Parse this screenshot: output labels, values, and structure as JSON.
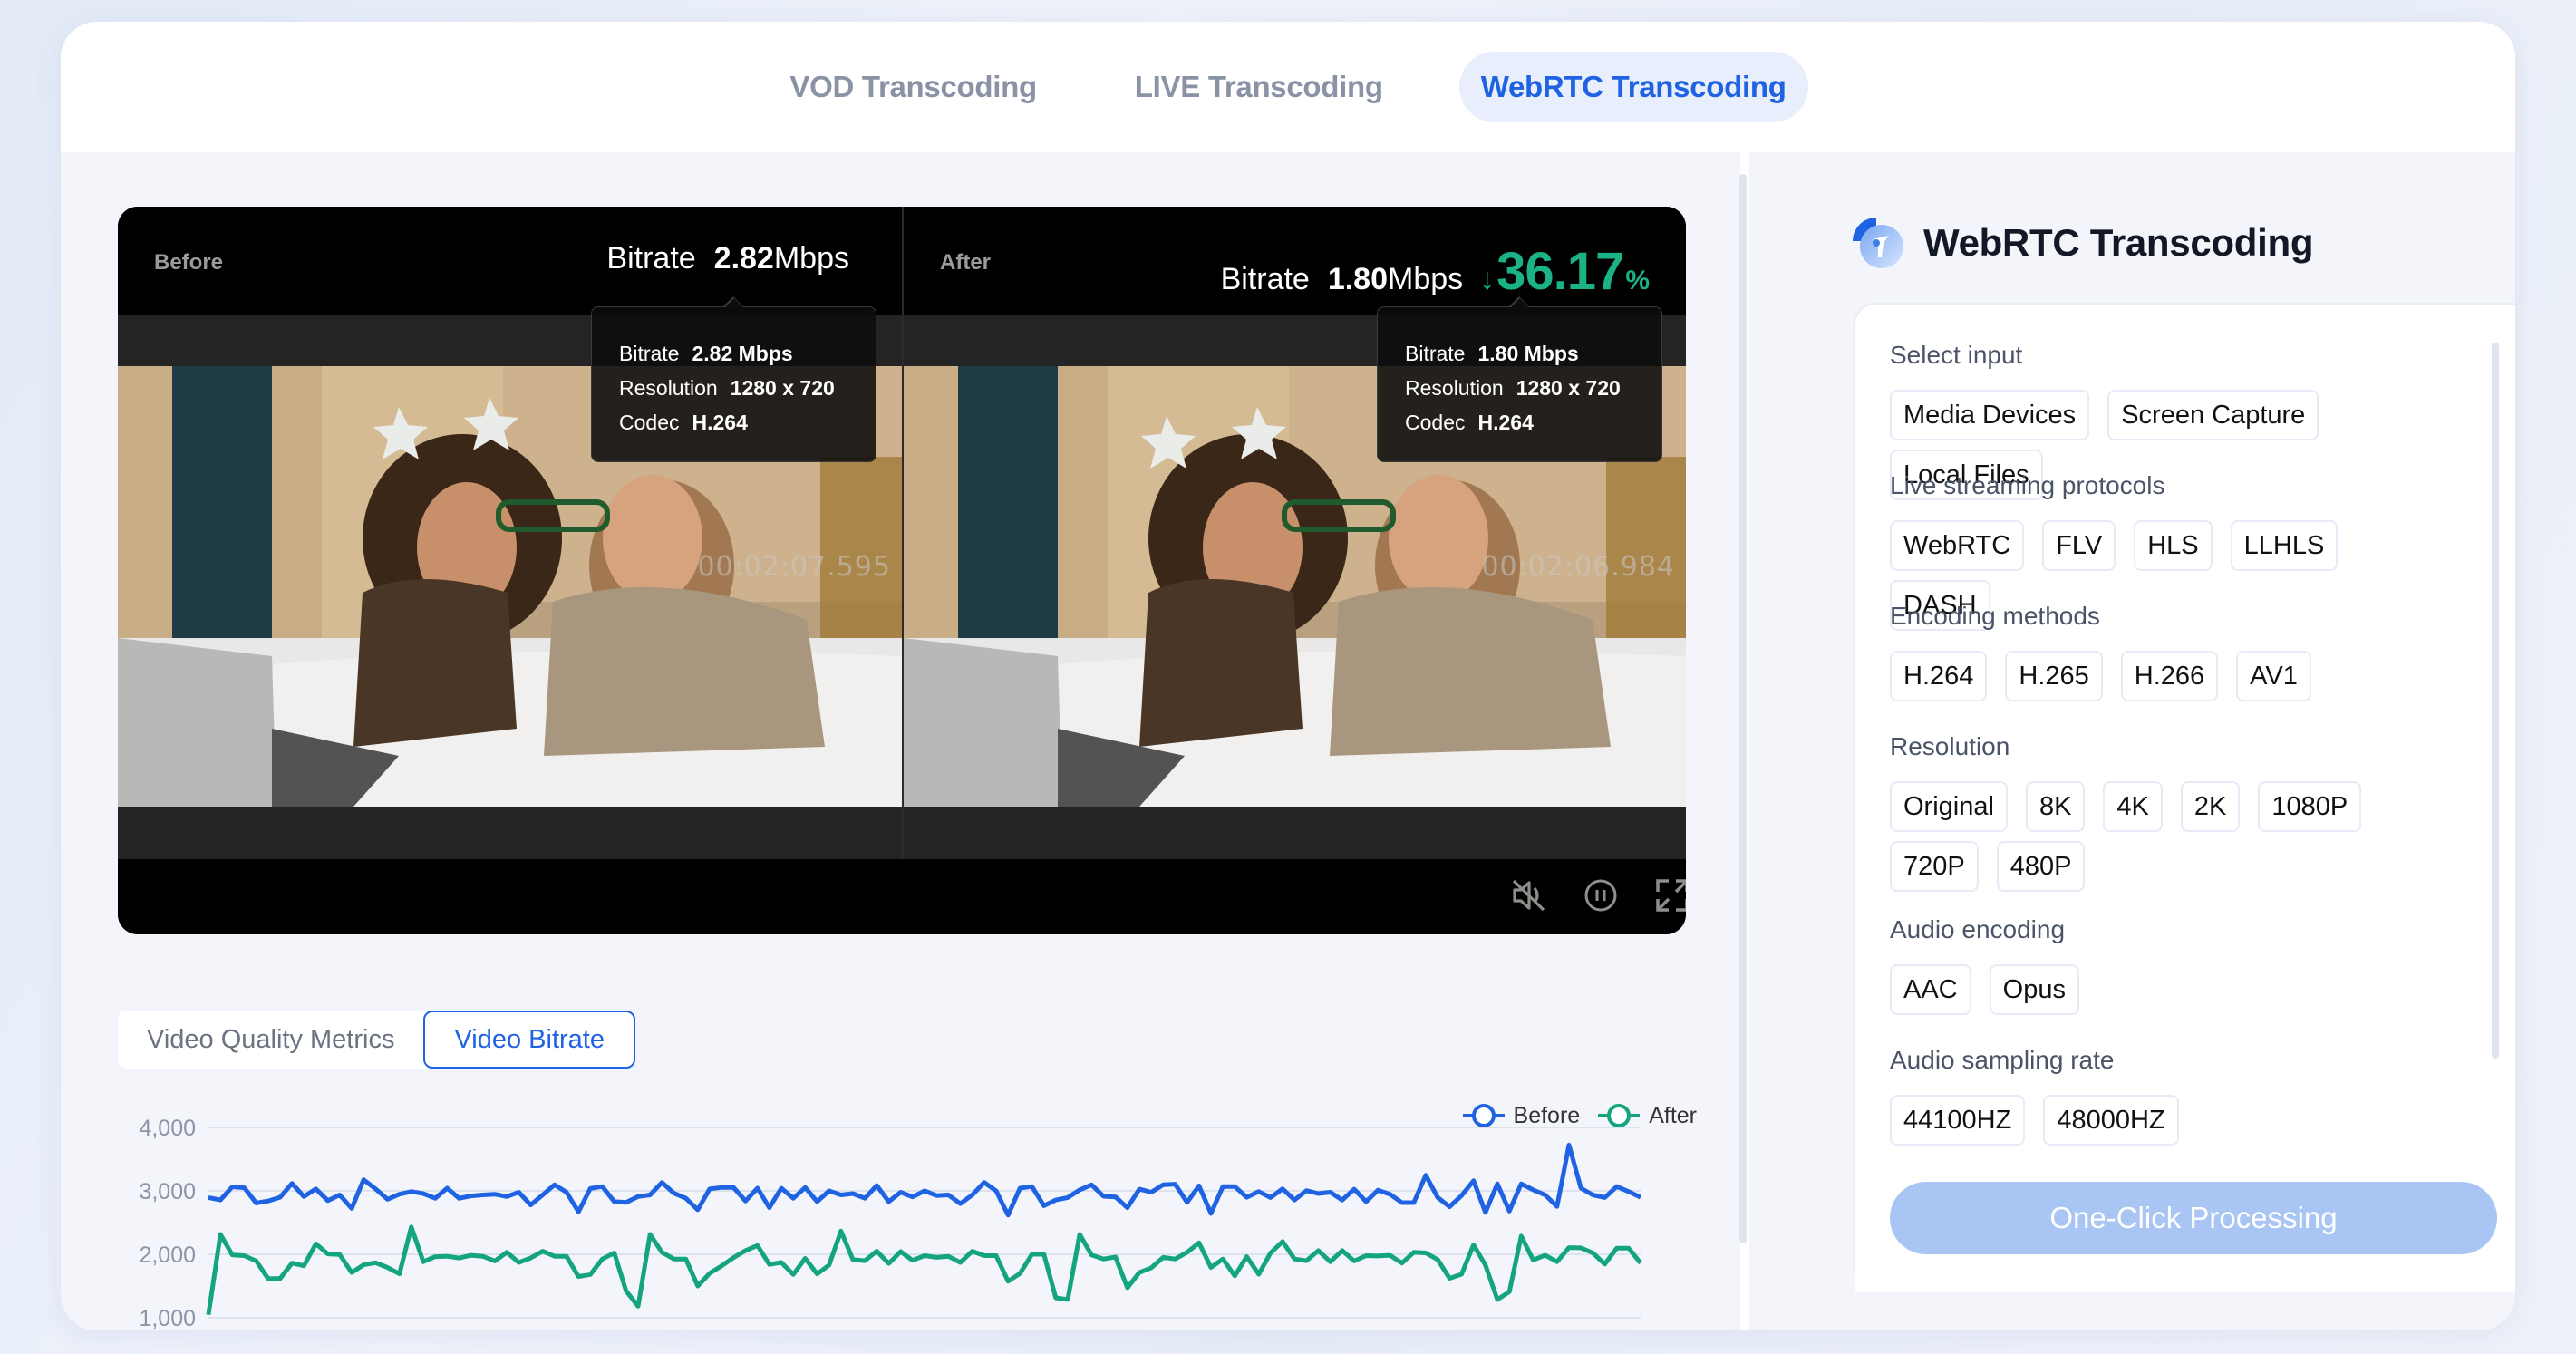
{
  "tabs": [
    {
      "label": "VOD Transcoding",
      "active": false
    },
    {
      "label": "LIVE Transcoding",
      "active": false
    },
    {
      "label": "WebRTC Transcoding",
      "active": true
    }
  ],
  "player": {
    "before": {
      "label": "Before",
      "bitrate_key": "Bitrate",
      "bitrate_value": "2.82",
      "bitrate_unit": "Mbps",
      "tooltip": {
        "bitrate_key": "Bitrate",
        "bitrate_value": "2.82 Mbps",
        "resolution_key": "Resolution",
        "resolution_value": "1280 x 720",
        "codec_key": "Codec",
        "codec_value": "H.264"
      },
      "timecode": "00:02:07.595"
    },
    "after": {
      "label": "After",
      "bitrate_key": "Bitrate",
      "bitrate_value": "1.80",
      "bitrate_unit": "Mbps",
      "savings_arrow": "↓",
      "savings_value": "36.17",
      "savings_unit": "%",
      "tooltip": {
        "bitrate_key": "Bitrate",
        "bitrate_value": "1.80 Mbps",
        "resolution_key": "Resolution",
        "resolution_value": "1280 x 720",
        "codec_key": "Codec",
        "codec_value": "H.264"
      },
      "timecode": "00:02:06.984"
    },
    "controls": {
      "mute": "mute-icon",
      "pause": "pause-icon",
      "fullscreen": "fullscreen-icon"
    }
  },
  "chart_tabs": [
    {
      "label": "Video Quality Metrics",
      "active": false
    },
    {
      "label": "Video Bitrate",
      "active": true
    }
  ],
  "colors": {
    "accent": "#1f63e3",
    "before_series": "#1f63e3",
    "after_series": "#14a57f",
    "savings": "#1bb285",
    "button_disabled": "#a9c5f4"
  },
  "chart_data": {
    "type": "line",
    "title": "",
    "xlabel": "",
    "ylabel": "",
    "ylim": [
      1000,
      4000
    ],
    "yticks": [
      1000,
      2000,
      3000,
      4000
    ],
    "ytick_labels": [
      "1,000",
      "2,000",
      "3,000",
      "4,000"
    ],
    "grid": true,
    "legend_position": "top-right",
    "series": [
      {
        "name": "Before",
        "values": [
          2894,
          2856,
          3064,
          3048,
          2809,
          2840,
          2899,
          3117,
          2910,
          3032,
          2846,
          2936,
          2723,
          3176,
          3032,
          2867,
          2947,
          2989,
          2957,
          2883,
          3043,
          2883,
          2920,
          2936,
          2947,
          2910,
          2979,
          2777,
          2936,
          3096,
          2979,
          2670,
          3037,
          3069,
          2830,
          2819,
          2910,
          2936,
          3133,
          2963,
          2883,
          2702,
          3032,
          3053,
          3053,
          2840,
          3043,
          2734,
          3043,
          2883,
          3053,
          2830,
          3000,
          2936,
          2957,
          2883,
          3085,
          2830,
          2979,
          2904,
          3000,
          2926,
          2936,
          2798,
          2936,
          3133,
          3000,
          2617,
          3043,
          3069,
          2766,
          2856,
          2894,
          3016,
          3096,
          2915,
          2904,
          2734,
          3027,
          2979,
          3096,
          3106,
          2819,
          3080,
          2644,
          3069,
          3069,
          2899,
          2989,
          2894,
          3032,
          2856,
          3005,
          2957,
          2979,
          2856,
          3027,
          2830,
          3011,
          2947,
          2814,
          2814,
          3245,
          2894,
          2750,
          2926,
          3160,
          2660,
          3112,
          2681,
          3112,
          3016,
          2936,
          2755,
          3723,
          3043,
          2936,
          2894,
          3069,
          2989,
          2899
        ]
      },
      {
        "name": "After",
        "values": [
          1048,
          2314,
          1989,
          1979,
          1894,
          1617,
          1617,
          1862,
          1819,
          2165,
          2005,
          1995,
          1713,
          1835,
          1867,
          1793,
          1691,
          2431,
          1883,
          1963,
          1968,
          1941,
          1984,
          1968,
          1894,
          2032,
          1872,
          1941,
          2048,
          1968,
          1968,
          1649,
          1681,
          1926,
          2021,
          1420,
          1181,
          2314,
          2032,
          1926,
          1926,
          1500,
          1702,
          1819,
          1947,
          2059,
          2138,
          1840,
          1872,
          1681,
          1936,
          1691,
          1830,
          2367,
          1915,
          1899,
          2048,
          1856,
          2043,
          1904,
          1979,
          1952,
          1968,
          1872,
          2048,
          1979,
          1979,
          1574,
          1697,
          2000,
          2000,
          1314,
          1287,
          2314,
          1989,
          1926,
          1957,
          1473,
          1713,
          1787,
          1952,
          1926,
          2032,
          2181,
          1793,
          1926,
          1660,
          1963,
          1686,
          2021,
          2202,
          1926,
          1899,
          2059,
          1883,
          2059,
          1894,
          1979,
          1973,
          1984,
          1862,
          2032,
          2021,
          1915,
          1622,
          1686,
          2149,
          1830,
          1287,
          1410,
          2287,
          1910,
          1984,
          1883,
          2106,
          2101,
          2021,
          1846,
          2096,
          2096,
          1862
        ]
      }
    ]
  },
  "right_panel": {
    "title": "WebRTC Transcoding",
    "icon": "webrtc-logo-icon",
    "sections": [
      {
        "label": "Select input",
        "options": [
          "Media Devices",
          "Screen Capture",
          "Local Files"
        ]
      },
      {
        "label": "Live streaming protocols",
        "options": [
          "WebRTC",
          "FLV",
          "HLS",
          "LLHLS",
          "DASH"
        ]
      },
      {
        "label": "Encoding methods",
        "options": [
          "H.264",
          "H.265",
          "H.266",
          "AV1"
        ]
      },
      {
        "label": "Resolution",
        "options": [
          "Original",
          "8K",
          "4K",
          "2K",
          "1080P",
          "720P",
          "480P"
        ]
      },
      {
        "label": "Audio encoding",
        "options": [
          "AAC",
          "Opus"
        ]
      },
      {
        "label": "Audio sampling rate",
        "options": [
          "44100HZ",
          "48000HZ"
        ]
      }
    ],
    "process_button": "One-Click Processing"
  }
}
